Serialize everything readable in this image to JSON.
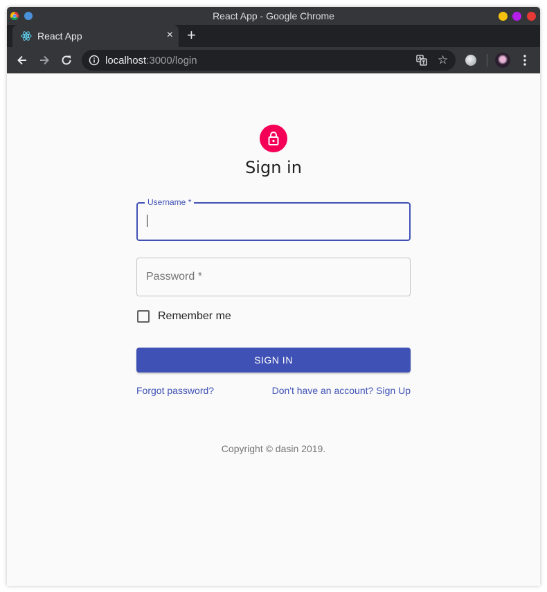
{
  "window": {
    "title": "React App - Google Chrome"
  },
  "tab": {
    "title": "React App",
    "favicon": "react-icon",
    "close": "×"
  },
  "new_tab_symbol": "+",
  "toolbar": {
    "url_host": "localhost",
    "url_path": ":3000/login",
    "star": "☆"
  },
  "page": {
    "heading": "Sign in",
    "username_label": "Username *",
    "password_placeholder": "Password *",
    "remember_label": "Remember me",
    "remember_checked": false,
    "signin_button": "SIGN IN",
    "forgot_link": "Forgot password?",
    "signup_link": "Don't have an account? Sign Up",
    "copyright": "Copyright © dasin 2019."
  },
  "colors": {
    "primary": "#3f51b5",
    "secondary": "#f50057",
    "chrome_dark": "#35363a"
  }
}
